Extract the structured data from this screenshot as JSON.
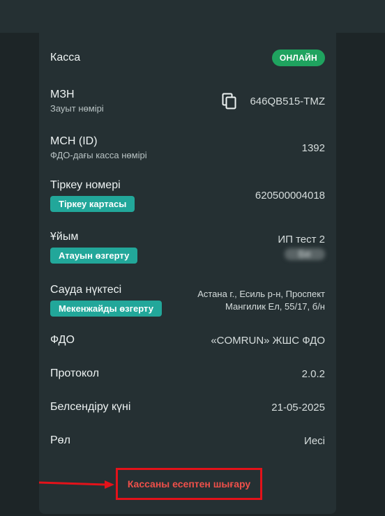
{
  "status": {
    "label": "Касса",
    "badge": "ОНЛАЙН",
    "badge_color": "#1fa35f"
  },
  "serial": {
    "label": "МЗН",
    "sublabel": "Зауыт нөмірі",
    "value": "646QB515-TMZ",
    "icon": "copy-icon"
  },
  "msn": {
    "label": "МСН (ID)",
    "sublabel": "ФДО-дағы касса нөмірі",
    "value": "1392"
  },
  "reg": {
    "label": "Тіркеу номері",
    "button": "Тіркеу картасы",
    "value": "620500004018"
  },
  "org": {
    "label": "Ұйым",
    "button": "Атауын өзгерту",
    "value": "ИП тест 2",
    "value2": "Бе"
  },
  "point": {
    "label": "Сауда нүктесі",
    "button": "Мекенжайды өзгерту",
    "address_line1": "Астана г., Есиль р-н, Проспект",
    "address_line2": "Мангилик Ел, 55/17, б/н"
  },
  "ofd": {
    "label": "ФДО",
    "value": "«COMRUN» ЖШС ФДО"
  },
  "protocol": {
    "label": "Протокол",
    "value": "2.0.2"
  },
  "activation": {
    "label": "Белсендіру күні",
    "value": "21-05-2025"
  },
  "role": {
    "label": "Рөл",
    "value": "Иесі"
  },
  "deregister": {
    "label": "Кассаны есептен шығару",
    "highlight_color": "#e3121a"
  }
}
